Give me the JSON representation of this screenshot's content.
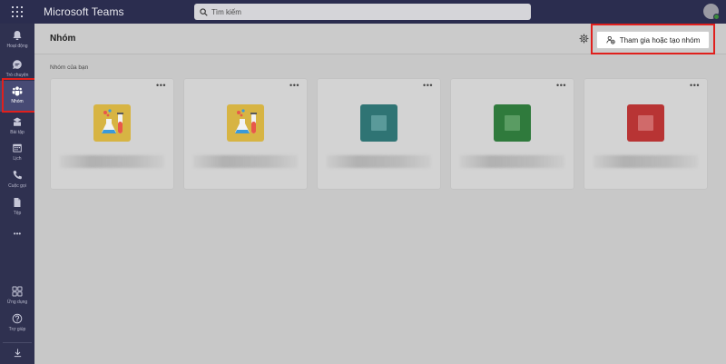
{
  "app": {
    "title": "Microsoft Teams"
  },
  "search": {
    "placeholder": "Tìm kiếm"
  },
  "rail": {
    "items": [
      {
        "label": "Hoạt động",
        "icon": "bell-icon"
      },
      {
        "label": "Trò chuyện",
        "icon": "chat-icon"
      },
      {
        "label": "Nhóm",
        "icon": "teams-icon",
        "active": true
      },
      {
        "label": "Bài tập",
        "icon": "assignments-icon"
      },
      {
        "label": "Lịch",
        "icon": "calendar-icon"
      },
      {
        "label": "Cuộc gọi",
        "icon": "phone-icon"
      },
      {
        "label": "Tệp",
        "icon": "file-icon"
      },
      {
        "label": "•••",
        "icon": "more-icon"
      },
      {
        "label": "Ứng dụng",
        "icon": "apps-icon"
      },
      {
        "label": "Trợ giúp",
        "icon": "help-icon"
      }
    ]
  },
  "header": {
    "title": "Nhóm",
    "join_button_label": "Tham gia hoặc tạo nhóm"
  },
  "section": {
    "label": "Nhóm của bạn"
  },
  "teams": [
    {
      "thumb": "science",
      "more": "•••"
    },
    {
      "thumb": "science",
      "more": "•••"
    },
    {
      "thumb": "teal",
      "more": "•••"
    },
    {
      "thumb": "green",
      "more": "•••"
    },
    {
      "thumb": "red",
      "more": "•••"
    }
  ],
  "colors": {
    "topbar": "#2b2d4f",
    "rail": "#2f3150",
    "rail_active": "#474a74",
    "highlight": "#e0201d",
    "status_available": "#3c8a3c"
  }
}
